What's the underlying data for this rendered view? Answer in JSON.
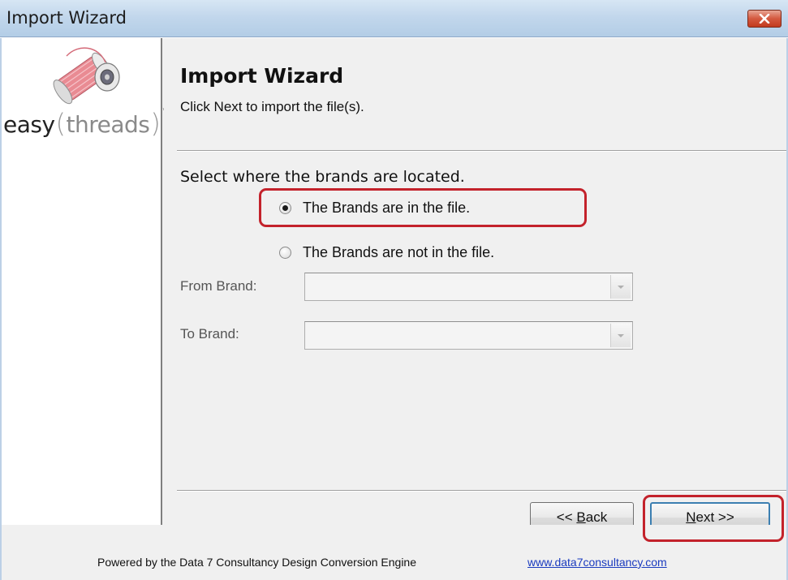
{
  "window": {
    "title": "Import Wizard",
    "close_icon": "close-icon"
  },
  "logo": {
    "word_easy": "easy",
    "word_threads": "threads",
    "trademark": "™",
    "icon": "thread-spool-icon"
  },
  "header": {
    "title": "Import Wizard",
    "subtitle": "Click Next to import the file(s)."
  },
  "content": {
    "prompt": "Select where the brands are located.",
    "options": [
      {
        "label": "The Brands are in the file.",
        "selected": true
      },
      {
        "label": "The Brands are not in the file.",
        "selected": false
      }
    ],
    "from_brand": {
      "label": "From Brand:",
      "value": "",
      "disabled": true
    },
    "to_brand": {
      "label": "To Brand:",
      "value": "",
      "disabled": true
    }
  },
  "buttons": {
    "back": {
      "prefix": "<< ",
      "mnemonic": "B",
      "rest": "ack"
    },
    "next": {
      "mnemonic": "N",
      "rest": "ext >>"
    }
  },
  "footer": {
    "powered_by": "Powered by the Data 7 Consultancy Design Conversion Engine",
    "link": "www.data7consultancy.com"
  },
  "colors": {
    "highlight": "#c3222b",
    "titlebar": "#c2d7ec",
    "close_button": "#d4593f",
    "link": "#1a3bbf"
  }
}
